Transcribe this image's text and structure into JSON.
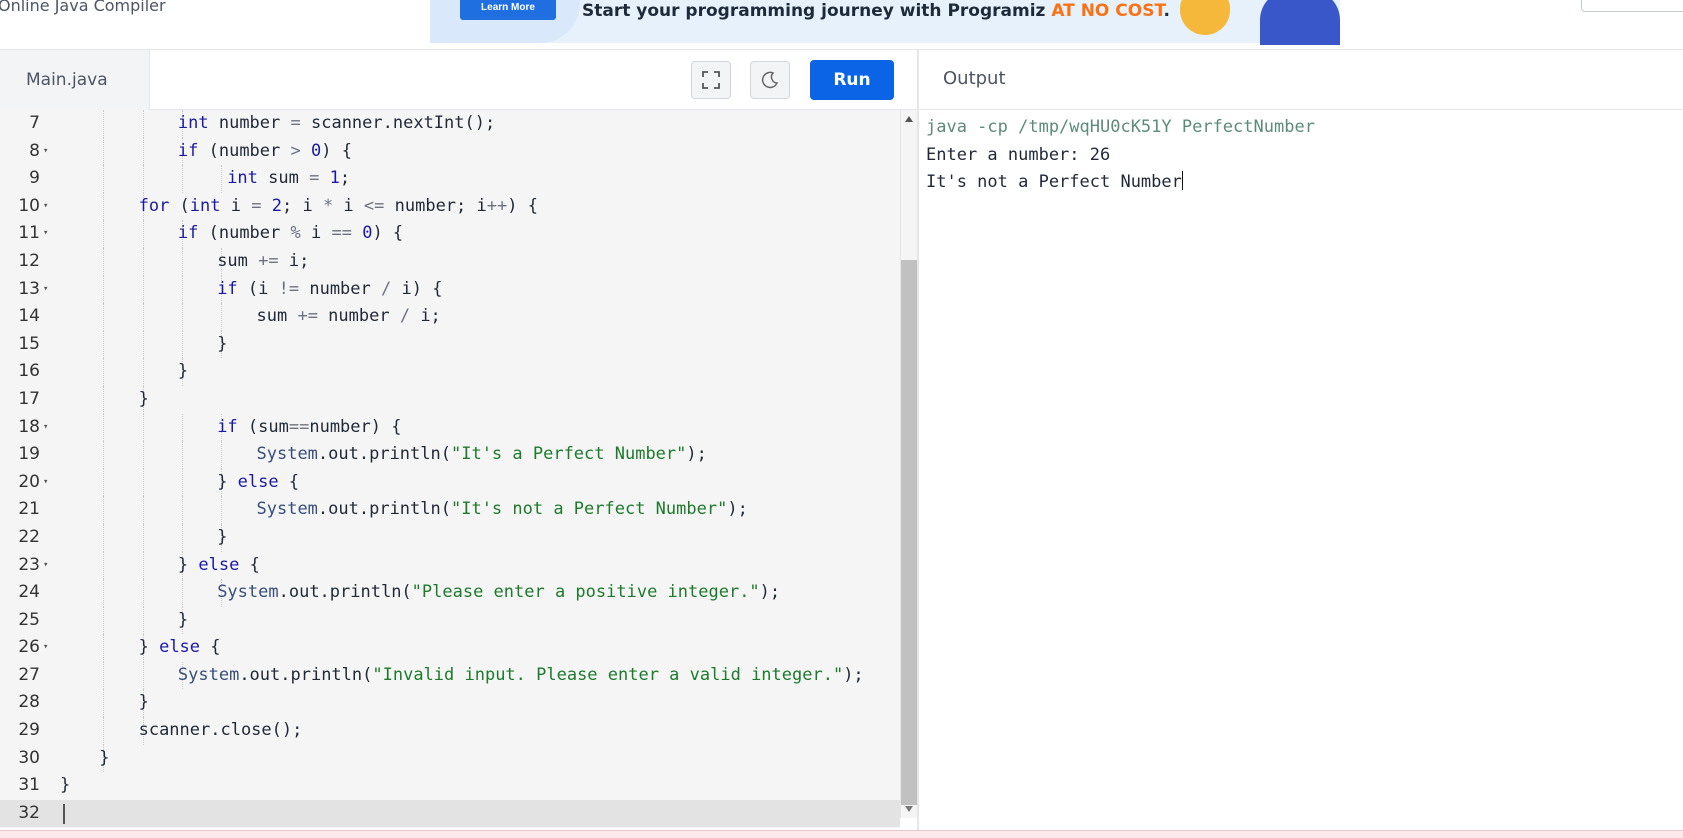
{
  "header": {
    "app_title": "Online Java Compiler",
    "ad": {
      "button_label": "Learn More",
      "text_main": "Start your programming journey with Programiz ",
      "text_accent": "AT NO COST",
      "text_end": "."
    }
  },
  "editor": {
    "file_tab": "Main.java",
    "run_label": "Run",
    "fullscreen_icon": "fullscreen-icon",
    "theme_icon": "moon-icon"
  },
  "code_lines": [
    {
      "n": "7",
      "fold": false,
      "indent": 3,
      "html": "<span class=\"kw\">int</span> number <span class=\"op\">=</span> scanner.nextInt();"
    },
    {
      "n": "8",
      "fold": true,
      "indent": 3,
      "html": "<span class=\"kw\">if</span> (number <span class=\"op\">&gt;</span> <span class=\"num\">0</span>) {"
    },
    {
      "n": "9",
      "fold": false,
      "indent": 4,
      "extra": 10,
      "html": "<span class=\"kw\">int</span> sum <span class=\"op\">=</span> <span class=\"num\">1</span>;"
    },
    {
      "n": "10",
      "fold": true,
      "indent": 2,
      "html": "<span class=\"kw\">for</span> (<span class=\"kw\">int</span> i <span class=\"op\">=</span> <span class=\"num\">2</span>; i <span class=\"op\">*</span> i <span class=\"op\">&lt;=</span> number; i<span class=\"op\">++</span>) {"
    },
    {
      "n": "11",
      "fold": true,
      "indent": 3,
      "html": "<span class=\"kw\">if</span> (number <span class=\"op\">%</span> i <span class=\"op\">==</span> <span class=\"num\">0</span>) {"
    },
    {
      "n": "12",
      "fold": false,
      "indent": 4,
      "html": "sum <span class=\"op\">+=</span> i;"
    },
    {
      "n": "13",
      "fold": true,
      "indent": 4,
      "html": "<span class=\"kw\">if</span> (i <span class=\"op\">!=</span> number <span class=\"op\">/</span> i) {"
    },
    {
      "n": "14",
      "fold": false,
      "indent": 5,
      "html": "sum <span class=\"op\">+=</span> number <span class=\"op\">/</span> i;"
    },
    {
      "n": "15",
      "fold": false,
      "indent": 4,
      "html": "}"
    },
    {
      "n": "16",
      "fold": false,
      "indent": 3,
      "html": "}"
    },
    {
      "n": "17",
      "fold": false,
      "indent": 2,
      "html": "}"
    },
    {
      "n": "18",
      "fold": true,
      "indent": 4,
      "html": "<span class=\"kw\">if</span> (sum<span class=\"op\">==</span>number) {"
    },
    {
      "n": "19",
      "fold": false,
      "indent": 5,
      "html": "<span class=\"cls\">System</span>.out.println(<span class=\"str\">\"It's a Perfect Number\"</span>);"
    },
    {
      "n": "20",
      "fold": true,
      "indent": 4,
      "html": "} <span class=\"kw\">else</span> {"
    },
    {
      "n": "21",
      "fold": false,
      "indent": 5,
      "html": "<span class=\"cls\">System</span>.out.println(<span class=\"str\">\"It's not a Perfect Number\"</span>);"
    },
    {
      "n": "22",
      "fold": false,
      "indent": 4,
      "html": "}"
    },
    {
      "n": "23",
      "fold": true,
      "indent": 3,
      "html": "} <span class=\"kw\">else</span> {"
    },
    {
      "n": "24",
      "fold": false,
      "indent": 4,
      "html": "<span class=\"cls\">System</span>.out.println(<span class=\"str\">\"Please enter a positive integer.\"</span>);"
    },
    {
      "n": "25",
      "fold": false,
      "indent": 3,
      "html": "}"
    },
    {
      "n": "26",
      "fold": true,
      "indent": 2,
      "html": "} <span class=\"kw\">else</span> {"
    },
    {
      "n": "27",
      "fold": false,
      "indent": 3,
      "html": "<span class=\"cls\">System</span>.out.println(<span class=\"str\">\"Invalid input. Please enter a valid integer.\"</span>);"
    },
    {
      "n": "28",
      "fold": false,
      "indent": 2,
      "html": "}"
    },
    {
      "n": "29",
      "fold": false,
      "indent": 2,
      "html": "scanner.close();"
    },
    {
      "n": "30",
      "fold": false,
      "indent": 1,
      "html": "}"
    },
    {
      "n": "31",
      "fold": false,
      "indent": 0,
      "html": "}"
    },
    {
      "n": "32",
      "fold": false,
      "indent": 0,
      "html": "",
      "active": true
    }
  ],
  "output": {
    "title": "Output",
    "lines": [
      {
        "text": "java -cp /tmp/wqHU0cK51Y PerfectNumber",
        "kind": "cmd"
      },
      {
        "text": "Enter a number: 26",
        "kind": "plain"
      },
      {
        "text": "It's not a Perfect Number",
        "kind": "plain",
        "cursor": true
      }
    ]
  },
  "colors": {
    "run_button": "#0b64e6",
    "ad_accent": "#f97316",
    "keyword": "#1a1aa6",
    "string": "#1d7a2c"
  }
}
